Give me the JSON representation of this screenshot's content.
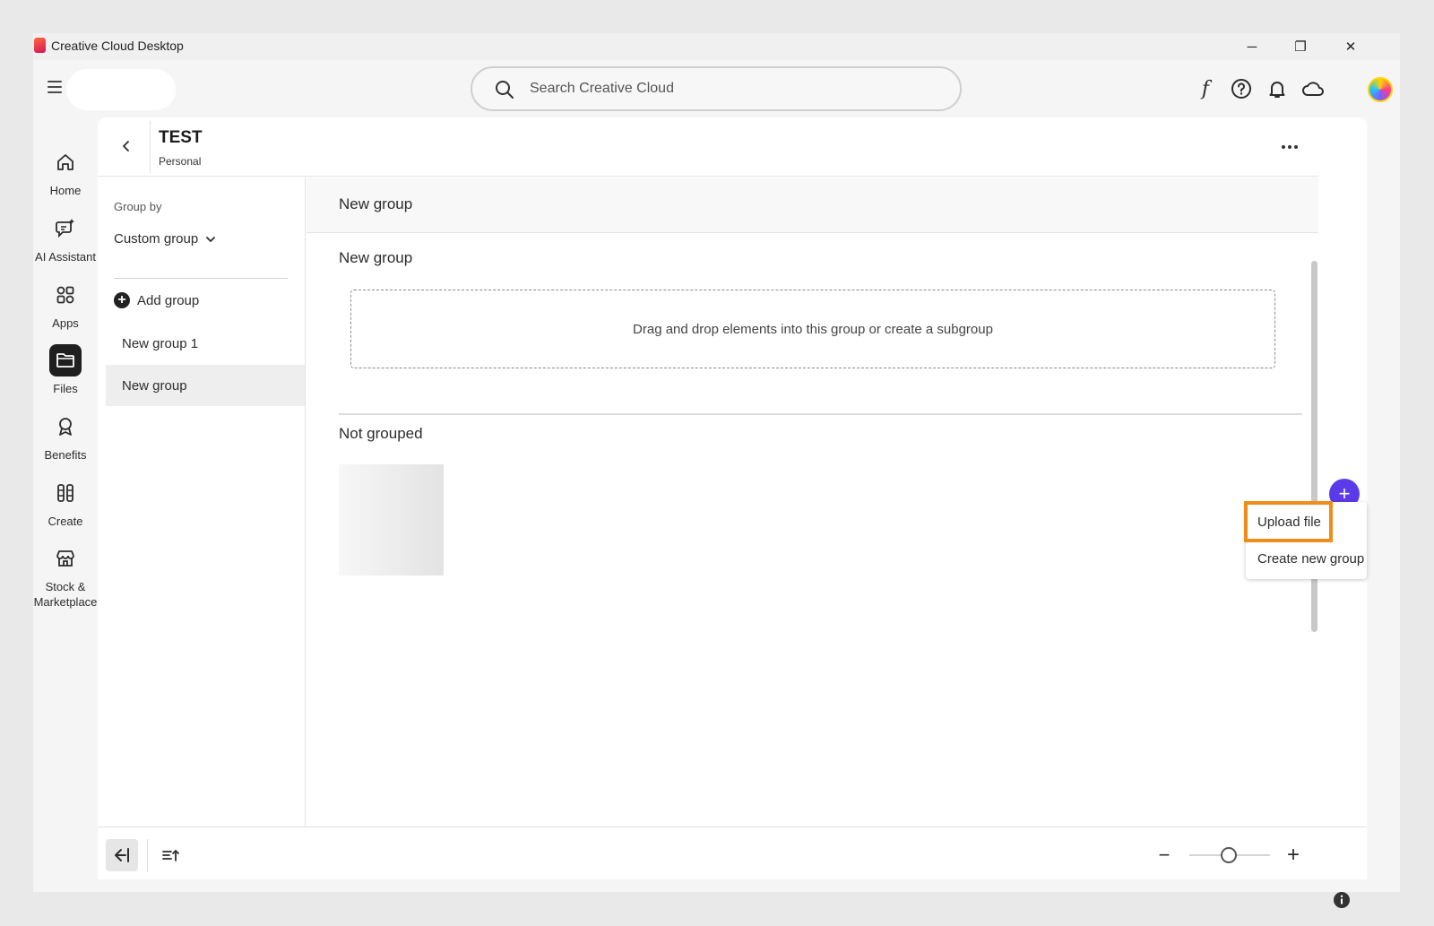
{
  "window": {
    "title": "Creative Cloud Desktop",
    "minimize": "─",
    "maximize": "❐",
    "close": "✕"
  },
  "search": {
    "placeholder": "Search Creative Cloud"
  },
  "leftnav": [
    {
      "label": "Home",
      "icon": "home-icon"
    },
    {
      "label": "AI Assistant",
      "icon": "ai-assistant-icon"
    },
    {
      "label": "Apps",
      "icon": "apps-icon"
    },
    {
      "label": "Files",
      "icon": "folder-icon",
      "active": true
    },
    {
      "label": "Benefits",
      "icon": "award-icon"
    },
    {
      "label": "Create",
      "icon": "create-icon"
    },
    {
      "label": "Stock &\nMarketplace",
      "icon": "store-icon"
    }
  ],
  "header": {
    "title": "TEST",
    "subtitle": "Personal"
  },
  "sidebar": {
    "group_by_label": "Group by",
    "group_by_value": "Custom group",
    "add_group": "Add group",
    "items": [
      {
        "label": "New group 1"
      },
      {
        "label": "New group",
        "selected": true
      }
    ]
  },
  "main": {
    "head_title": "New group",
    "group_title": "New group",
    "dropzone_text": "Drag and drop elements into this group or create a subgroup",
    "not_grouped_title": "Not grouped"
  },
  "fab": {
    "symbol": "+"
  },
  "menu": {
    "items": [
      {
        "label": "Upload file",
        "highlighted": true
      },
      {
        "label": "Create new group"
      }
    ]
  },
  "zoom": {
    "minus": "−",
    "plus": "+"
  },
  "colors": {
    "accent": "#5b3be8",
    "highlight": "#f08c1a"
  }
}
